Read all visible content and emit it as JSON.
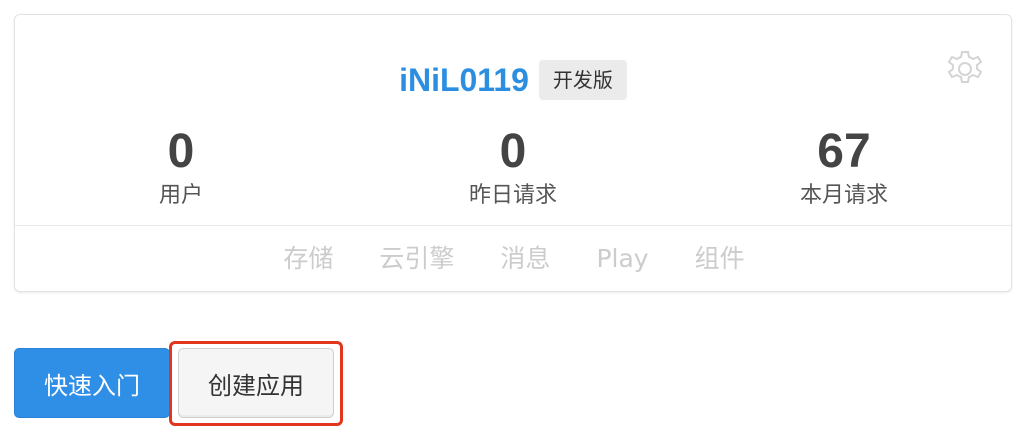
{
  "app": {
    "name": "iNiL0119",
    "edition": "开发版",
    "settings_icon": "gear-icon"
  },
  "stats": [
    {
      "value": "0",
      "label": "用户"
    },
    {
      "value": "0",
      "label": "昨日请求"
    },
    {
      "value": "67",
      "label": "本月请求"
    }
  ],
  "tabs": [
    "存储",
    "云引擎",
    "消息",
    "Play",
    "组件"
  ],
  "actions": {
    "quick_start": "快速入门",
    "create_app": "创建应用"
  },
  "colors": {
    "accent": "#2b8ee0",
    "highlight_border": "#e2361c"
  }
}
